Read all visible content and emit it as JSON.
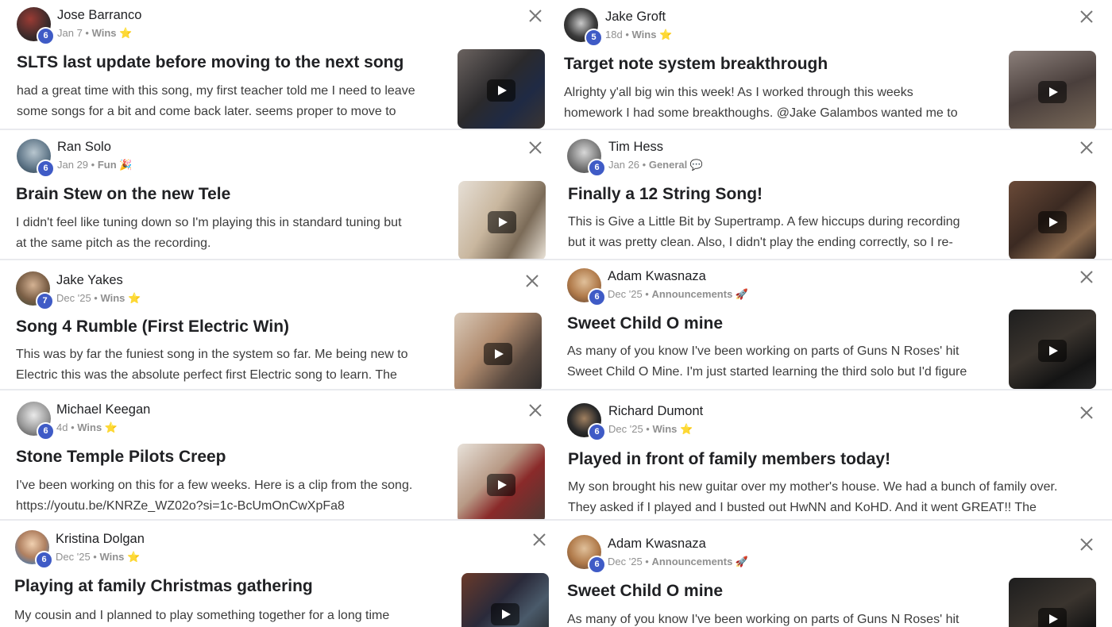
{
  "posts": [
    {
      "author": "Jose Barranco",
      "level": "6",
      "time": "Jan 7",
      "category": "Wins",
      "emoji": "⭐",
      "title": "SLTS last update before moving to the next song",
      "line1": "had a great time with this song, my first teacher told me I need to leave",
      "line2": "some songs for a bit and come back later. seems proper to move to"
    },
    {
      "author": "Jake Groft",
      "level": "5",
      "time": "18d",
      "category": "Wins",
      "emoji": "⭐",
      "title": "Target note system breakthrough",
      "line1": "Alrighty y'all big win this week! As I worked through this weeks",
      "line2": "homework I had some breakthoughs. @Jake Galambos wanted me to"
    },
    {
      "author": "Ran Solo",
      "level": "6",
      "time": "Jan 29",
      "category": "Fun",
      "emoji": "🎉",
      "title": "Brain Stew on the new Tele",
      "line1": "I didn't feel like tuning down so I'm playing this in standard tuning but",
      "line2": "at the same pitch as the recording."
    },
    {
      "author": "Tim Hess",
      "level": "6",
      "time": "Jan 26",
      "category": "General",
      "emoji": "💬",
      "title": "Finally a 12 String Song!",
      "line1": "This is Give a Little Bit by Supertramp. A few hiccups during recording",
      "line2": "but it was pretty clean. Also, I didn't play the ending correctly, so I re-"
    },
    {
      "author": "Jake Yakes",
      "level": "7",
      "time": "Dec '25",
      "category": "Wins",
      "emoji": "⭐",
      "title": "Song 4 Rumble (First Electric Win)",
      "line1": "This was by far the funiest song in the system so far. Me being new to",
      "line2": "Electric this was the absolute perfect first Electric song to learn. The"
    },
    {
      "author": "Adam Kwasnaza",
      "level": "6",
      "time": "Dec '25",
      "category": "Announcements",
      "emoji": "🚀",
      "title": "Sweet Child O mine",
      "line1": "As many of you know I've been working on parts of Guns N Roses' hit",
      "line2": "Sweet Child O Mine. I'm just started learning the third solo but I'd figure"
    },
    {
      "author": "Michael Keegan",
      "level": "6",
      "time": "4d",
      "category": "Wins",
      "emoji": "⭐",
      "title": "Stone Temple Pilots Creep",
      "line1": "I've been working on this for a few weeks. Here is a clip from the song.",
      "line2": "https://youtu.be/KNRZe_WZ02o?si=1c-BcUmOnCwXpFa8"
    },
    {
      "author": "Richard Dumont",
      "level": "6",
      "time": "Dec '25",
      "category": "Wins",
      "emoji": "⭐",
      "title": "Played in front of family members today!",
      "line1": "My son brought his new guitar over my mother's house. We had a bunch of family over.",
      "line2": "They asked if I played and I busted out HwNN and KoHD. And it went GREAT!! The"
    },
    {
      "author": "Kristina Dolgan",
      "level": "6",
      "time": "Dec '25",
      "category": "Wins",
      "emoji": "⭐",
      "title": "Playing at family Christmas gathering",
      "line1": "My cousin and I planned to play something together for a long time",
      "line2": ""
    },
    {
      "author": "Adam Kwasnaza",
      "level": "6",
      "time": "Dec '25",
      "category": "Announcements",
      "emoji": "🚀",
      "title": "Sweet Child O mine",
      "line1": "As many of you know I've been working on parts of Guns N Roses' hit",
      "line2": ""
    }
  ],
  "colors": {
    "level_badge": "#3f5bc6",
    "meta_text": "#909090",
    "title_text": "#202124",
    "card_bg": "#ffffff",
    "page_bg": "#e9eaee"
  },
  "icons": {
    "close": "close-icon",
    "play": "play-icon"
  }
}
